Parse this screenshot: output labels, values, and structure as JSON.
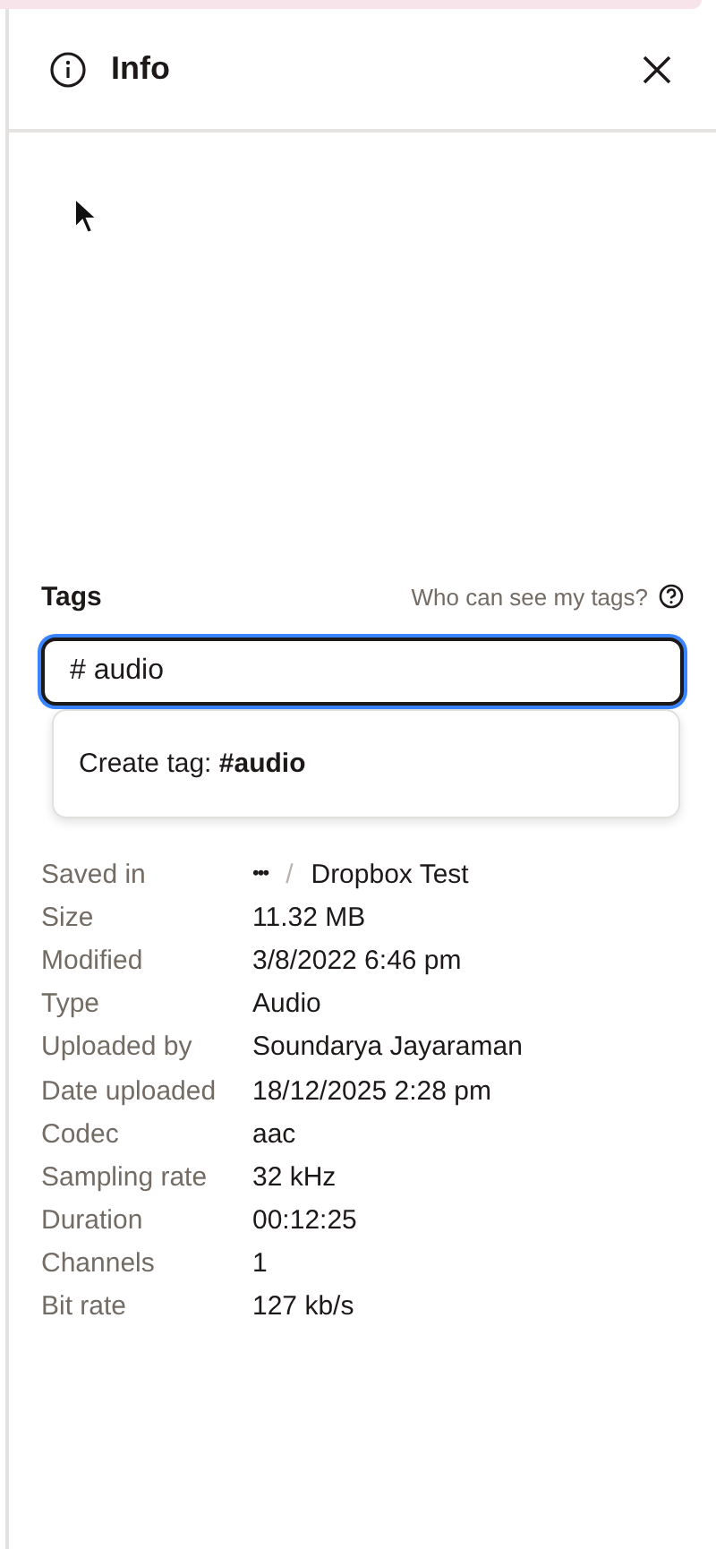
{
  "panel": {
    "title": "Info"
  },
  "tags": {
    "label": "Tags",
    "help_link": "Who can see my tags?",
    "value": "# audio",
    "focused": true,
    "suggestion": "Create tag: **#audio**"
  },
  "saved_in": {
    "label": "Saved in",
    "ellipsis": "•••",
    "separator": "/",
    "folder": "Dropbox Test"
  },
  "details": [
    {
      "label": "Size",
      "value": "11.32 MB"
    },
    {
      "label": "Modified",
      "value": "3/8/2022 6:46 pm"
    },
    {
      "label": "Type",
      "value": "Audio"
    },
    {
      "label": "Uploaded by",
      "value": "Soundarya Jayaraman"
    },
    {
      "label": "Date uploaded",
      "value": "18/12/2025 2:28 pm"
    },
    {
      "label": "Codec",
      "value": "aac"
    },
    {
      "label": "Sampling rate",
      "value": "32 kHz"
    },
    {
      "label": "Duration",
      "value": "00:12:25"
    },
    {
      "label": "Channels",
      "value": "1"
    },
    {
      "label": "Bit rate",
      "value": "127 kb/s"
    }
  ]
}
